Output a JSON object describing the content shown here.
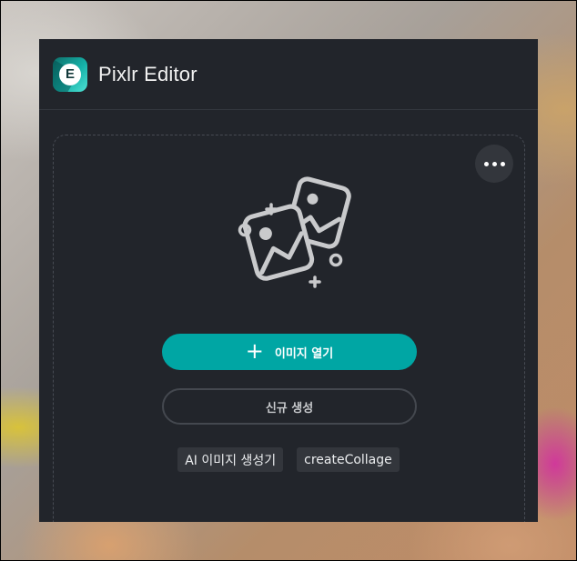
{
  "header": {
    "app_title": "Pixlr Editor",
    "logo_letter": "E",
    "logo_icon": "pixlr-e-logo-icon"
  },
  "menu": {
    "icon": "more-horizontal-icon"
  },
  "hero": {
    "icon": "images-sparkle-icon"
  },
  "actions": {
    "open_image_label": "이미지 열기",
    "open_image_icon": "plus-icon",
    "new_label": "신규 생성"
  },
  "chips": [
    {
      "label": "AI 이미지 생성기"
    },
    {
      "label": "createCollage"
    }
  ],
  "colors": {
    "panel_bg": "#22252b",
    "accent": "#00a6a4",
    "chip_bg": "#33363c"
  }
}
